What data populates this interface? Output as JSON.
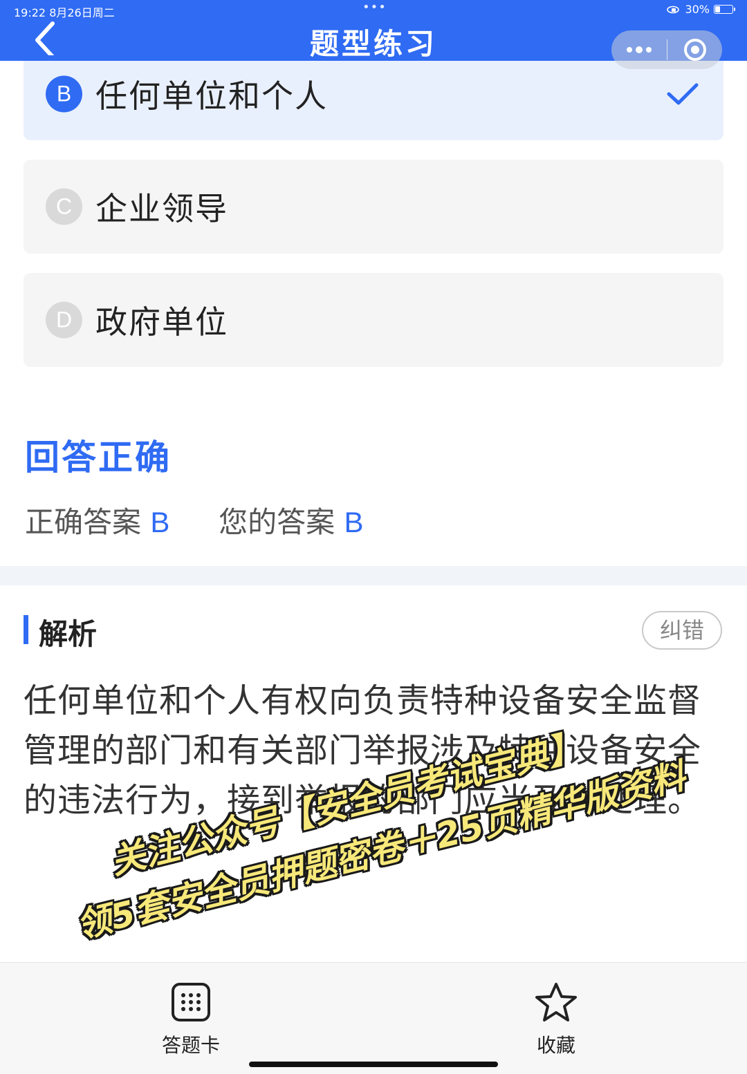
{
  "status_bar": {
    "time_date": "19:22  8月26日周二",
    "battery": "30%",
    "battery_level": 0.3
  },
  "header": {
    "title": "题型练习"
  },
  "options": [
    {
      "letter": "B",
      "text": "任何单位和个人",
      "selected": true
    },
    {
      "letter": "C",
      "text": "企业领导",
      "selected": false
    },
    {
      "letter": "D",
      "text": "政府单位",
      "selected": false
    }
  ],
  "result": {
    "title": "回答正确",
    "correct_label": "正确答案",
    "correct_value": "B",
    "your_label": "您的答案",
    "your_value": "B"
  },
  "analysis": {
    "title": "解析",
    "report_button": "纠错",
    "text": "任何单位和个人有权向负责特种设备安全监督管理的部门和有关部门举报涉及特种设备安全的违法行为，接到举报的部门应当及时处理。"
  },
  "promo": {
    "line1": "关注公众号【安全员考试宝典】",
    "line2": "领5套安全员押题密卷＋25页精华版资料"
  },
  "bottom_bar": {
    "card_label": "答题卡",
    "favorite_label": "收藏"
  },
  "colors": {
    "primary": "#2f6bf3",
    "selected_bg": "#e9f0fd",
    "option_bg": "#f5f5f5",
    "promo_text": "#f7e87a"
  }
}
